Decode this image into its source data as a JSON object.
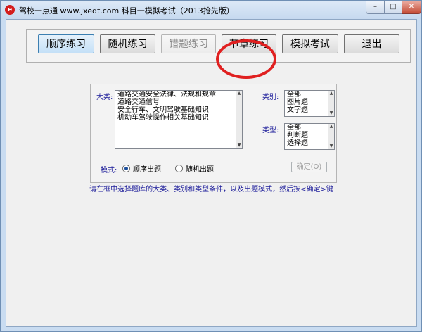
{
  "window": {
    "title": "驾校一点通 www.jxedt.com 科目一模拟考试（2013抢先版）",
    "icon": "e",
    "controls": {
      "minimize": "–",
      "maximize": "□",
      "close": "✕"
    }
  },
  "toolbar": {
    "buttons": [
      {
        "label": "顺序练习",
        "state": "active"
      },
      {
        "label": "随机练习",
        "state": "normal"
      },
      {
        "label": "错题练习",
        "state": "disabled"
      },
      {
        "label": "节章练习",
        "state": "normal"
      },
      {
        "label": "模拟考试",
        "state": "normal"
      },
      {
        "label": "退出",
        "state": "normal"
      }
    ]
  },
  "filter": {
    "category_label": "大类:",
    "categories": [
      "道路交通安全法律、法规和规章",
      "道路交通信号",
      "安全行车、文明驾驶基础知识",
      "机动车驾驶操作相关基础知识"
    ],
    "kind_label": "类别:",
    "kinds": [
      "全部",
      "图片题",
      "文字题"
    ],
    "type_label": "类型:",
    "types": [
      "全部",
      "判断题",
      "选择题"
    ],
    "mode_label": "模式:",
    "mode_options": [
      "顺序出题",
      "随机出题"
    ],
    "mode_selected": 0,
    "confirm_label": "确定(O)"
  },
  "instructions": "请在框中选择题库的大类、类别和类型条件，以及出题模式，然后按<确定>键",
  "colors": {
    "label_blue": "#1c1c9a",
    "highlight": "#e02020",
    "active_button": "#c4e0f7"
  }
}
